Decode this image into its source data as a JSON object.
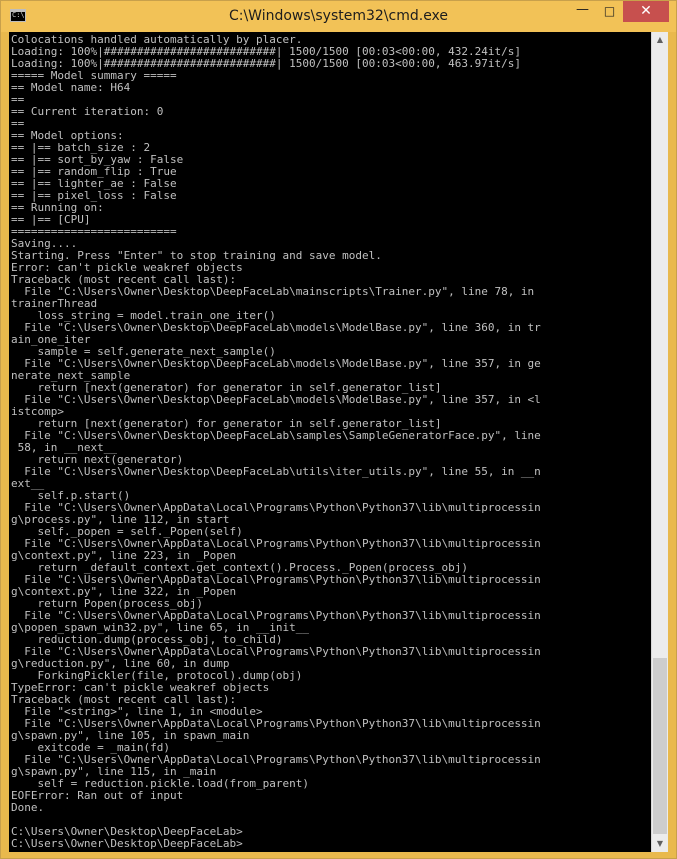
{
  "window": {
    "title": "C:\\Windows\\system32\\cmd.exe",
    "icon_label": "C:\\",
    "buttons": {
      "minimize": "—",
      "maximize": "□",
      "close": "✕"
    }
  },
  "console": {
    "text": "Colocations handled automatically by placer.\nLoading: 100%|##########################| 1500/1500 [00:03<00:00, 432.24it/s]\nLoading: 100%|##########################| 1500/1500 [00:03<00:00, 463.97it/s]\n===== Model summary =====\n== Model name: H64\n==\n== Current iteration: 0\n==\n== Model options:\n== |== batch_size : 2\n== |== sort_by_yaw : False\n== |== random_flip : True\n== |== lighter_ae : False\n== |== pixel_loss : False\n== Running on:\n== |== [CPU]\n=========================\nSaving....\nStarting. Press \"Enter\" to stop training and save model.\nError: can't pickle weakref objects\nTraceback (most recent call last):\n  File \"C:\\Users\\Owner\\Desktop\\DeepFaceLab\\mainscripts\\Trainer.py\", line 78, in\ntrainerThread\n    loss_string = model.train_one_iter()\n  File \"C:\\Users\\Owner\\Desktop\\DeepFaceLab\\models\\ModelBase.py\", line 360, in tr\nain_one_iter\n    sample = self.generate_next_sample()\n  File \"C:\\Users\\Owner\\Desktop\\DeepFaceLab\\models\\ModelBase.py\", line 357, in ge\nnerate_next_sample\n    return [next(generator) for generator in self.generator_list]\n  File \"C:\\Users\\Owner\\Desktop\\DeepFaceLab\\models\\ModelBase.py\", line 357, in <l\nistcomp>\n    return [next(generator) for generator in self.generator_list]\n  File \"C:\\Users\\Owner\\Desktop\\DeepFaceLab\\samples\\SampleGeneratorFace.py\", line\n 58, in __next__\n    return next(generator)\n  File \"C:\\Users\\Owner\\Desktop\\DeepFaceLab\\utils\\iter_utils.py\", line 55, in __n\next__\n    self.p.start()\n  File \"C:\\Users\\Owner\\AppData\\Local\\Programs\\Python\\Python37\\lib\\multiprocessin\ng\\process.py\", line 112, in start\n    self._popen = self._Popen(self)\n  File \"C:\\Users\\Owner\\AppData\\Local\\Programs\\Python\\Python37\\lib\\multiprocessin\ng\\context.py\", line 223, in _Popen\n    return _default_context.get_context().Process._Popen(process_obj)\n  File \"C:\\Users\\Owner\\AppData\\Local\\Programs\\Python\\Python37\\lib\\multiprocessin\ng\\context.py\", line 322, in _Popen\n    return Popen(process_obj)\n  File \"C:\\Users\\Owner\\AppData\\Local\\Programs\\Python\\Python37\\lib\\multiprocessin\ng\\popen_spawn_win32.py\", line 65, in __init__\n    reduction.dump(process_obj, to_child)\n  File \"C:\\Users\\Owner\\AppData\\Local\\Programs\\Python\\Python37\\lib\\multiprocessin\ng\\reduction.py\", line 60, in dump\n    ForkingPickler(file, protocol).dump(obj)\nTypeError: can't pickle weakref objects\nTraceback (most recent call last):\n  File \"<string>\", line 1, in <module>\n  File \"C:\\Users\\Owner\\AppData\\Local\\Programs\\Python\\Python37\\lib\\multiprocessin\ng\\spawn.py\", line 105, in spawn_main\n    exitcode = _main(fd)\n  File \"C:\\Users\\Owner\\AppData\\Local\\Programs\\Python\\Python37\\lib\\multiprocessin\ng\\spawn.py\", line 115, in _main\n    self = reduction.pickle.load(from_parent)\nEOFError: Ran out of input\nDone.\n\nC:\\Users\\Owner\\Desktop\\DeepFaceLab>\nC:\\Users\\Owner\\Desktop\\DeepFaceLab>",
    "text_color": "#c0c0c0",
    "background": "#000000"
  },
  "scrollbar": {
    "up_arrow": "▲",
    "down_arrow": "▼"
  },
  "theme": {
    "title_bar_color": "#f2c257",
    "close_button_color": "#c7504e"
  }
}
